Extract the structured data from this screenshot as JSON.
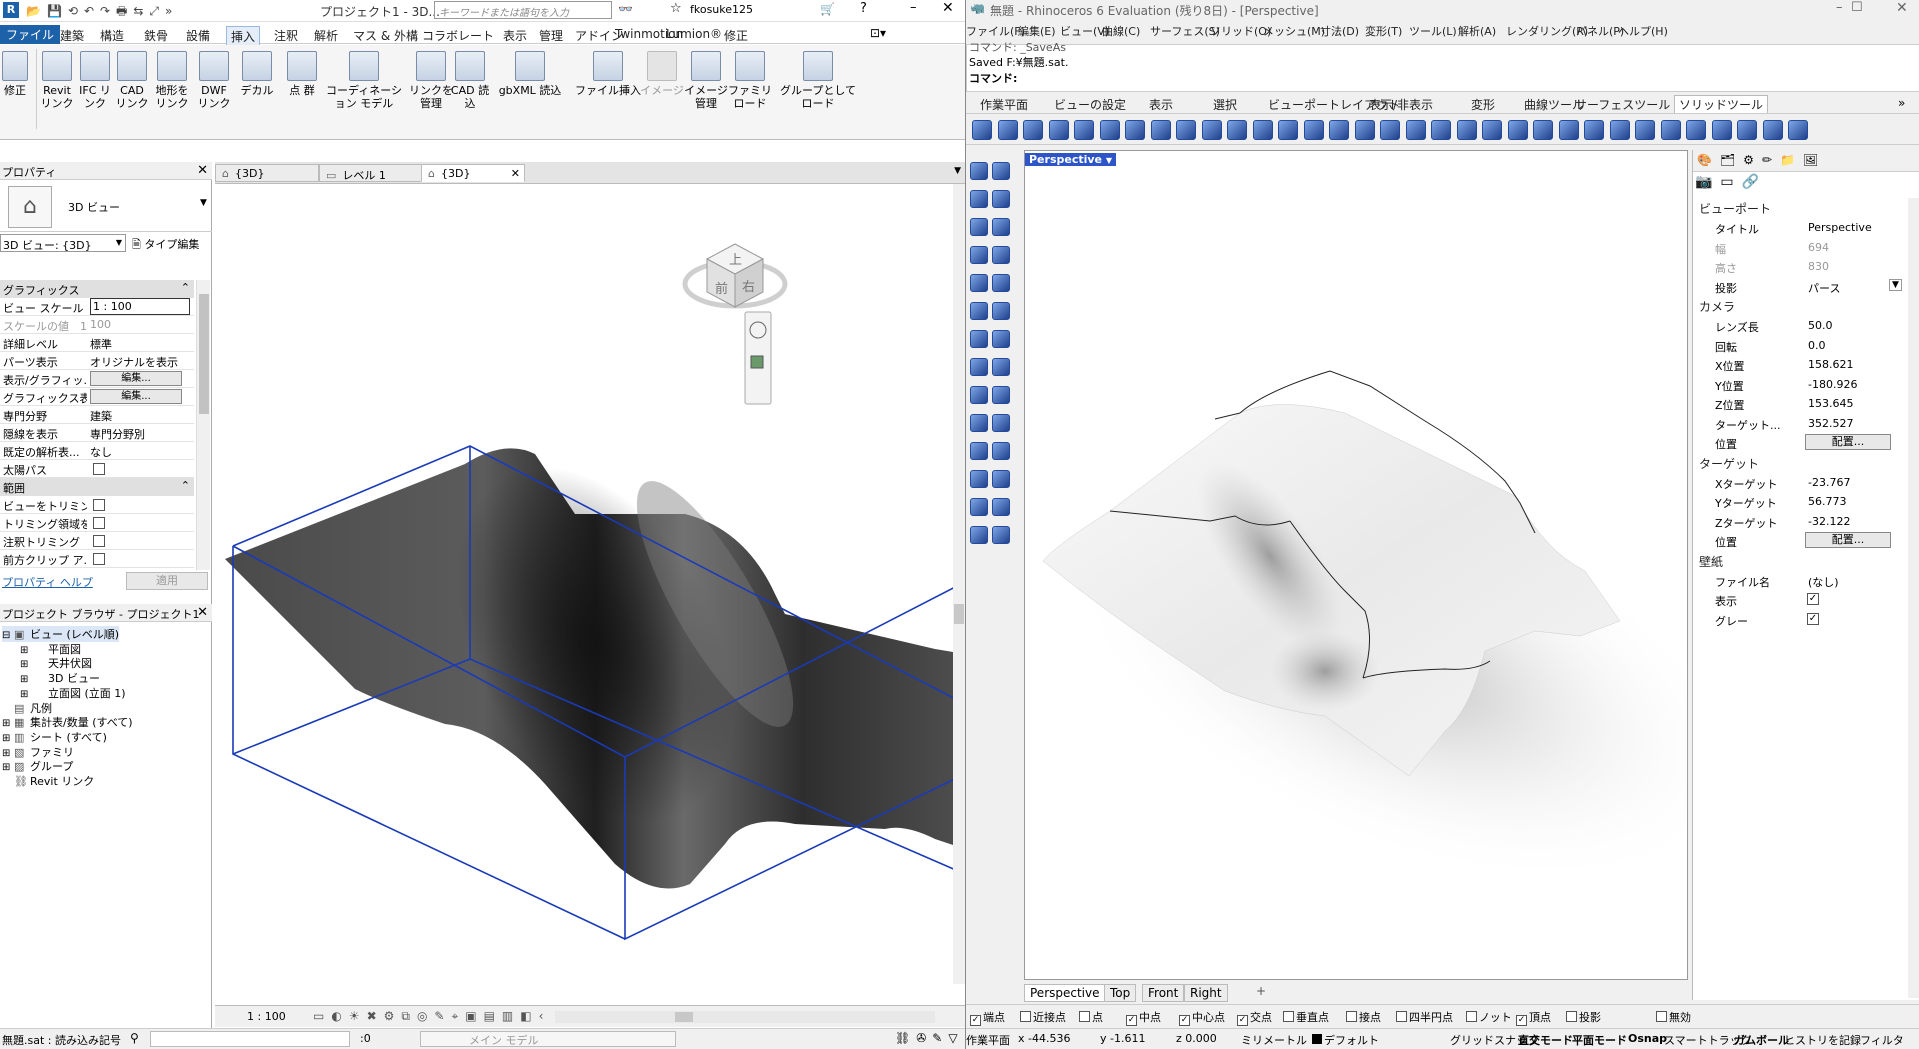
{
  "revit": {
    "title": "プロジェクト1 - 3D...",
    "search_placeholder": "キーワードまたは語句を入力",
    "user": "fkosuke125",
    "menu": [
      "ファイル",
      "建築",
      "構造",
      "鉄骨",
      "設備",
      "挿入",
      "注釈",
      "解析",
      "マス & 外構",
      "コラボレート",
      "表示",
      "管理",
      "アドイン",
      "Twinmotion",
      "Lumion®",
      "修正"
    ],
    "ribbon": [
      "修正",
      "Revit リンク",
      "IFC リンク",
      "CAD リンク",
      "地形を リンク",
      "DWF リンク",
      "デカル",
      "点 群",
      "コーディネーション モデル",
      "リンクを 管理",
      "CAD 読込",
      "gbXML 読込",
      "ファイル挿入",
      "イメージ",
      "イメージ 管理",
      "ファミリ ロード",
      "グループとして ロード"
    ],
    "props": {
      "header": "プロパティ",
      "type_name": "3D ビュー",
      "instance": "3D ビュー: {3D}",
      "type_edit": "タイプ編集",
      "sec_graphics": "グラフィックス",
      "rows": [
        {
          "k": "ビュー スケール",
          "v": "1 : 100"
        },
        {
          "k": "スケールの値　1:",
          "v": "100"
        },
        {
          "k": "詳細レベル",
          "v": "標準"
        },
        {
          "k": "パーツ表示",
          "v": "オリジナルを表示"
        },
        {
          "k": "表示/グラフィッ...",
          "v": "編集..."
        },
        {
          "k": "グラフィックス表...",
          "v": "編集..."
        },
        {
          "k": "専門分野",
          "v": "建築"
        },
        {
          "k": "隠線を表示",
          "v": "専門分野別"
        },
        {
          "k": "既定の解析表...",
          "v": "なし"
        },
        {
          "k": "太陽パス",
          "v": ""
        }
      ],
      "sec_range": "範囲",
      "rows2": [
        {
          "k": "ビューをトリミング",
          "v": ""
        },
        {
          "k": "トリミング領域を...",
          "v": ""
        },
        {
          "k": "注釈トリミング",
          "v": ""
        },
        {
          "k": "前方クリップ ア...",
          "v": ""
        }
      ],
      "help": "プロパティ ヘルプ",
      "apply": "適用"
    },
    "browser": {
      "header": "プロジェクト ブラウザ - プロジェクト1",
      "items": [
        "ビュー (レベル順)",
        "平面図",
        "天井伏図",
        "3D ビュー",
        "立面図 (立面 1)",
        "凡例",
        "集計表/数量 (すべて)",
        "シート (すべて)",
        "ファミリ",
        "グループ",
        "Revit リンク"
      ]
    },
    "view_tabs": [
      "{3D}",
      "レベル 1",
      "{3D}"
    ],
    "viewcube": {
      "top": "上",
      "front": "前",
      "right": "右"
    },
    "scale": "1 : 100",
    "status_left": "無題.sat : 読み込み記号",
    "status_count": ":0",
    "status_model": "メイン モデル"
  },
  "rhino": {
    "title": "無題 - Rhinoceros 6 Evaluation (残り8日) - [Perspective]",
    "menu": [
      "ファイル(F)",
      "編集(E)",
      "ビュー(V)",
      "曲線(C)",
      "サーフェス(S)",
      "ソリッド(O)",
      "メッシュ(M)",
      "寸法(D)",
      "変形(T)",
      "ツール(L)",
      "解析(A)",
      "レンダリング(R)",
      "パネル(P)",
      "ヘルプ(H)"
    ],
    "cmd_history": [
      "コマンド: _SaveAs",
      "Saved F:¥無題.sat."
    ],
    "cmd_prompt": "コマンド:",
    "tabs": [
      "作業平面",
      "ビューの設定",
      "表示",
      "選択",
      "ビューポートレイアウト",
      "表示/非表示",
      "変形",
      "曲線ツール",
      "サーフェスツール",
      "ソリッドツール"
    ],
    "viewport_label": "Perspective",
    "viewport_tabs": [
      "Perspective",
      "Top",
      "Front",
      "Right"
    ],
    "panel": {
      "viewport": "ビューポート",
      "rows1": [
        {
          "k": "タイトル",
          "v": "Perspective"
        },
        {
          "k": "幅",
          "v": "694"
        },
        {
          "k": "高さ",
          "v": "830"
        },
        {
          "k": "投影",
          "v": "パース"
        }
      ],
      "camera": "カメラ",
      "rows2": [
        {
          "k": "レンズ長",
          "v": "50.0"
        },
        {
          "k": "回転",
          "v": "0.0"
        },
        {
          "k": "X位置",
          "v": "158.621"
        },
        {
          "k": "Y位置",
          "v": "-180.926"
        },
        {
          "k": "Z位置",
          "v": "153.645"
        },
        {
          "k": "ターゲット...",
          "v": "352.527"
        },
        {
          "k": "位置",
          "v": "配置..."
        }
      ],
      "target": "ターゲット",
      "rows3": [
        {
          "k": "Xターゲット",
          "v": "-23.767"
        },
        {
          "k": "Yターゲット",
          "v": "56.773"
        },
        {
          "k": "Zターゲット",
          "v": "-32.122"
        },
        {
          "k": "位置",
          "v": "配置..."
        }
      ],
      "wallpaper": "壁紙",
      "rows4": [
        {
          "k": "ファイル名",
          "v": "(なし)"
        },
        {
          "k": "表示",
          "v": ""
        },
        {
          "k": "グレー",
          "v": ""
        }
      ]
    },
    "osnap": [
      {
        "l": "端点",
        "c": true
      },
      {
        "l": "近接点",
        "c": false
      },
      {
        "l": "点",
        "c": false
      },
      {
        "l": "中点",
        "c": true
      },
      {
        "l": "中心点",
        "c": true
      },
      {
        "l": "交点",
        "c": true
      },
      {
        "l": "垂直点",
        "c": false
      },
      {
        "l": "接点",
        "c": false
      },
      {
        "l": "四半円点",
        "c": false
      },
      {
        "l": "ノット",
        "c": false
      },
      {
        "l": "頂点",
        "c": true
      },
      {
        "l": "投影",
        "c": false
      },
      {
        "l": "無効",
        "c": false
      }
    ],
    "status": {
      "plane": "作業平面",
      "x": "x -44.536",
      "y": "y -1.611",
      "z": "z 0.000",
      "unit": "ミリメートル",
      "layer": "デフォルト",
      "grid": "グリッドスナップ",
      "ortho": "直交モード",
      "planar": "平面モード",
      "osnap": "Osnap",
      "smart": "スマートトラック",
      "gumball": "ガムボール",
      "history": "ヒストリを記録",
      "filter": "フィルタ"
    }
  }
}
